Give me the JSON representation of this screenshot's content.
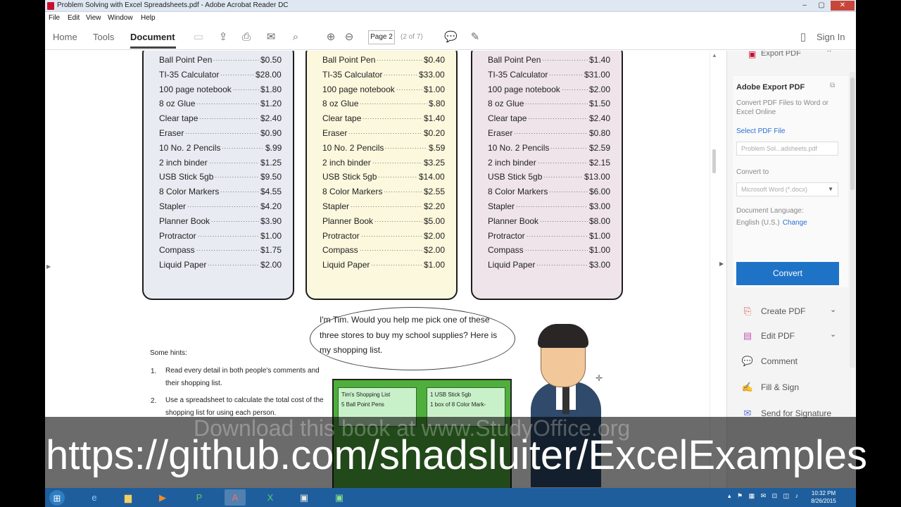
{
  "window": {
    "title": "Problem Solving with Excel Spreadsheets.pdf - Adobe Acrobat Reader DC",
    "controls": {
      "minimize": "–",
      "maximize": "▢",
      "close": "✕"
    }
  },
  "menu": [
    "File",
    "Edit",
    "View",
    "Window",
    "Help"
  ],
  "toolbar": {
    "tabs": [
      "Home",
      "Tools",
      "Document"
    ],
    "active_tab": "Document",
    "page_number": "Page 2",
    "page_of": "(2 of 7)",
    "sign_in": "Sign In",
    "icons": [
      "save-icon",
      "upload-icon",
      "print-icon",
      "mail-icon",
      "search-icon",
      "page-up-icon",
      "page-down-icon",
      "comment-icon",
      "pen-icon",
      "mobile-icon"
    ]
  },
  "document": {
    "stores": [
      {
        "items": [
          {
            "name": "Ball Point Pen",
            "price": "$0.50"
          },
          {
            "name": "TI-35 Calculator",
            "price": "$28.00"
          },
          {
            "name": "100 page notebook",
            "price": "$1.80"
          },
          {
            "name": "8 oz Glue",
            "price": "$1.20"
          },
          {
            "name": "Clear tape",
            "price": "$2.40"
          },
          {
            "name": "Eraser",
            "price": "$0.90"
          },
          {
            "name": "10 No. 2 Pencils",
            "price": "$.99"
          },
          {
            "name": "2 inch binder",
            "price": "$1.25"
          },
          {
            "name": "USB Stick 5gb",
            "price": "$9.50"
          },
          {
            "name": "8 Color Markers",
            "price": "$4.55"
          },
          {
            "name": "Stapler",
            "price": "$4.20"
          },
          {
            "name": "Planner Book",
            "price": "$3.90"
          },
          {
            "name": "Protractor",
            "price": "$1.00"
          },
          {
            "name": "Compass",
            "price": "$1.75"
          },
          {
            "name": "Liquid Paper",
            "price": "$2.00"
          }
        ]
      },
      {
        "items": [
          {
            "name": "Ball Point Pen",
            "price": "$0.40"
          },
          {
            "name": "TI-35 Calculator",
            "price": "$33.00"
          },
          {
            "name": "100 page notebook",
            "price": "$1.00"
          },
          {
            "name": "8 oz Glue",
            "price": "$.80"
          },
          {
            "name": "Clear tape",
            "price": "$1.40"
          },
          {
            "name": "Eraser",
            "price": "$0.20"
          },
          {
            "name": "10 No. 2 Pencils",
            "price": "$.59"
          },
          {
            "name": "2 inch binder",
            "price": "$3.25"
          },
          {
            "name": "USB Stick 5gb",
            "price": "$14.00"
          },
          {
            "name": "8 Color Markers",
            "price": "$2.55"
          },
          {
            "name": "Stapler",
            "price": "$2.20"
          },
          {
            "name": "Planner Book",
            "price": "$5.00"
          },
          {
            "name": "Protractor",
            "price": "$2.00"
          },
          {
            "name": "Compass",
            "price": "$2.00"
          },
          {
            "name": "Liquid Paper",
            "price": "$1.00"
          }
        ]
      },
      {
        "items": [
          {
            "name": "Ball Point Pen",
            "price": "$1.40"
          },
          {
            "name": "TI-35 Calculator",
            "price": "$31.00"
          },
          {
            "name": "100 page notebook",
            "price": "$2.00"
          },
          {
            "name": "8 oz Glue",
            "price": "$1.50"
          },
          {
            "name": "Clear tape",
            "price": "$2.40"
          },
          {
            "name": "Eraser",
            "price": "$0.80"
          },
          {
            "name": "10 No. 2 Pencils",
            "price": "$2.59"
          },
          {
            "name": "2 inch binder",
            "price": "$2.15"
          },
          {
            "name": "USB Stick 5gb",
            "price": "$13.00"
          },
          {
            "name": "8 Color Markers",
            "price": "$6.00"
          },
          {
            "name": "Stapler",
            "price": "$3.00"
          },
          {
            "name": "Planner Book",
            "price": "$8.00"
          },
          {
            "name": "Protractor",
            "price": "$1.00"
          },
          {
            "name": "Compass",
            "price": "$1.00"
          },
          {
            "name": "Liquid Paper",
            "price": "$3.00"
          }
        ]
      }
    ],
    "bubble_text": "I'm Tim. Would you help me pick one of these three stores to buy my school supplies? Here is my shopping list.",
    "hints_title": "Some hints:",
    "hints": [
      {
        "num": "1.",
        "text": "Read every detail in both people's comments and their shopping list."
      },
      {
        "num": "2.",
        "text": "Use a spreadsheet to calculate the total cost of the shopping list for using each person."
      }
    ],
    "mini_sheet": {
      "left_title": "Tim's Shopping List",
      "left_line": "5 Ball Point Pens",
      "right_title": "1 USB Stick 5gb",
      "right_line": "1 box of 8 Color Mark-"
    }
  },
  "right_pane": {
    "header": "Export PDF",
    "title": "Adobe Export PDF",
    "description": "Convert PDF Files to Word or Excel Online",
    "select_label": "Select PDF File",
    "file_name": "Problem Sol...adsheets.pdf",
    "convert_to_label": "Convert to",
    "convert_to_value": "Microsoft Word (*.docx)",
    "language_label": "Document Language:",
    "language_value": "English (U.S.)",
    "language_change": "Change",
    "convert_button": "Convert",
    "tools": [
      {
        "label": "Create PDF",
        "icon": "create-pdf-icon",
        "color": "#d9534f"
      },
      {
        "label": "Edit PDF",
        "icon": "edit-pdf-icon",
        "color": "#c45ab3"
      },
      {
        "label": "Comment",
        "icon": "comment-icon",
        "color": "#e8c43a"
      },
      {
        "label": "Fill & Sign",
        "icon": "fill-sign-icon",
        "color": "#5a6fd6"
      },
      {
        "label": "Send for Signature",
        "icon": "send-signature-icon",
        "color": "#5a6fd6"
      }
    ]
  },
  "overlay": {
    "watermark": "Download this book at www.StudyOffice.org",
    "url": "https://github.com/shadsluiter/ExcelExamples"
  },
  "taskbar": {
    "apps": [
      "start-button",
      "internet-explorer-icon",
      "file-explorer-icon",
      "media-player-icon",
      "project-icon",
      "acrobat-icon",
      "excel-icon",
      "app-icon",
      "app-icon-2"
    ],
    "clock_time": "10:32 PM",
    "clock_date": "8/26/2015"
  },
  "colors": {
    "accent": "#1f73c7",
    "acrobat_red": "#c8102e",
    "taskbar": "#1f5e9c"
  }
}
